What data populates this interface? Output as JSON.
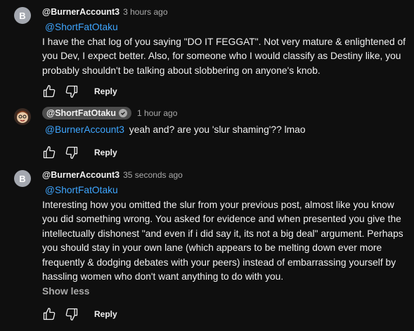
{
  "comments": [
    {
      "avatar_letter": "B",
      "author": "@BurnerAccount3",
      "time": "3 hours ago",
      "mention": "@ShortFatOtaku",
      "text": "I have the chat log of you saying \"DO IT FEGGAT\". Not very mature & enlightened of you Dev, I expect better. Also, for someone who I would classify as Destiny like, you probably shouldn't be talking about slobbering on anyone's knob.",
      "reply_label": "Reply"
    },
    {
      "author": "@ShortFatOtaku",
      "time": "1 hour ago",
      "mention": "@BurnerAccount3",
      "text": "yeah and? are you 'slur shaming'?? lmao",
      "reply_label": "Reply"
    },
    {
      "avatar_letter": "B",
      "author": "@BurnerAccount3",
      "time": "35 seconds ago",
      "mention": "@ShortFatOtaku",
      "text": "Interesting how you omitted the slur from your previous post, almost like you know you did something wrong. You asked for evidence and when presented you give the intellectually dishonest \"and even if i did say it, its not a big deal\" argument. Perhaps you should stay in your own lane (which appears to be melting down ever more frequently & dodging debates with your peers) instead of embarrassing yourself by hassling women who don't want anything to do with you.",
      "show_less": "Show less",
      "reply_label": "Reply"
    }
  ],
  "colors": {
    "background": "#0f0f0f",
    "text": "#f1f1f1",
    "mention": "#3ea6ff",
    "muted": "#aaaaaa",
    "chip": "#4d4d4d"
  },
  "icons": [
    "like-icon",
    "dislike-icon",
    "verified-icon"
  ]
}
